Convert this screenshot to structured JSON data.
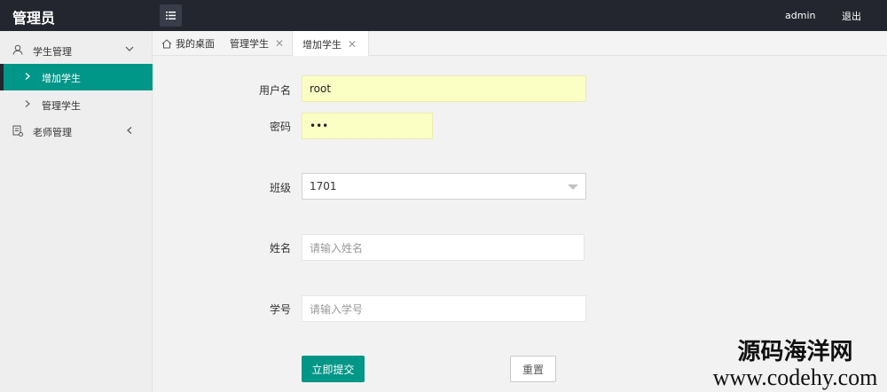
{
  "header": {
    "brand": "管理员",
    "user": "admin",
    "logout": "退出"
  },
  "sidebar": {
    "groups": [
      {
        "label": "学生管理",
        "expanded": true,
        "items": [
          "增加学生",
          "管理学生"
        ]
      },
      {
        "label": "老师管理",
        "expanded": false
      }
    ],
    "active_item": "增加学生"
  },
  "tabs": [
    {
      "label": "我的桌面",
      "closable": false
    },
    {
      "label": "管理学生",
      "closable": true
    },
    {
      "label": "增加学生",
      "closable": true,
      "active": true
    }
  ],
  "form": {
    "username": {
      "label": "用户名",
      "value": "root"
    },
    "password": {
      "label": "密码",
      "value": "•••"
    },
    "class": {
      "label": "班级",
      "value": "1701"
    },
    "name": {
      "label": "姓名",
      "placeholder": "请输入姓名"
    },
    "student_no": {
      "label": "学号",
      "placeholder": "请输入学号"
    },
    "submit": "立即提交",
    "reset": "重置"
  },
  "watermark": {
    "line1": "源码海洋网",
    "line2": "www.codehy.com"
  },
  "colors": {
    "topbar": "#23262e",
    "accent": "#009688",
    "autofill": "#fbffc4"
  }
}
